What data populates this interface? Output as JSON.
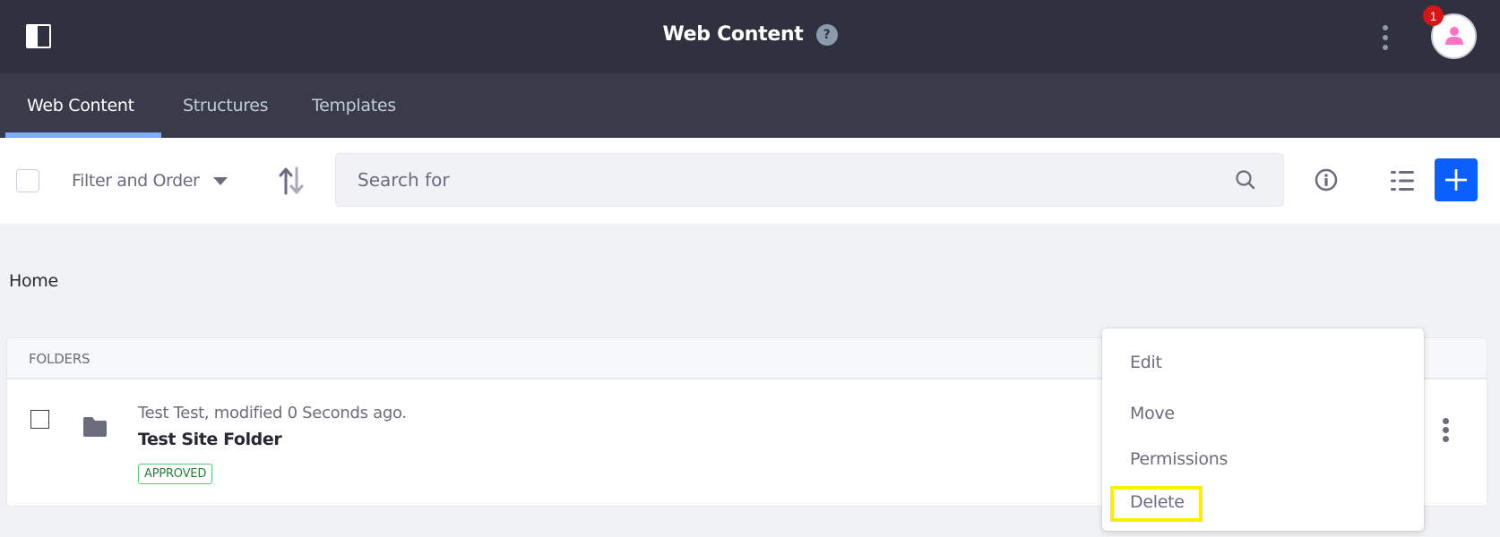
{
  "header": {
    "title": "Web Content",
    "help_icon": "question-mark-icon",
    "notification_count": "1",
    "sidebar_toggle_icon": "sidebar-toggle-icon",
    "options_icon": "vertical-ellipsis-icon",
    "avatar_icon": "user-icon"
  },
  "tabs": [
    {
      "label": "Web Content",
      "active": true
    },
    {
      "label": "Structures",
      "active": false
    },
    {
      "label": "Templates",
      "active": false
    }
  ],
  "toolbar": {
    "filter_label": "Filter and Order",
    "search_placeholder": "Search for",
    "search_value": "",
    "icons": {
      "sort": "order-arrows-icon",
      "search": "search-icon",
      "info": "info-circle-icon",
      "view": "list-view-icon",
      "add": "plus-icon"
    }
  },
  "breadcrumb": {
    "items": [
      "Home"
    ]
  },
  "folders": {
    "section_label": "FOLDERS",
    "rows": [
      {
        "meta": "Test Test, modified 0 Seconds ago.",
        "title": "Test Site Folder",
        "status": "APPROVED",
        "icon": "folder-icon"
      }
    ]
  },
  "dropdown_menu": {
    "items": [
      {
        "label": "Edit"
      },
      {
        "label": "Move"
      },
      {
        "label": "Permissions"
      },
      {
        "label": "Delete",
        "highlighted": true
      }
    ],
    "highlight_color": "#ffee00"
  },
  "colors": {
    "header_bg": "#30313f",
    "tabs_bg": "#393a4a",
    "active_tab_underline": "#80acff",
    "primary": "#0b5fff",
    "notification": "#da1414",
    "approved": "#287d3c",
    "avatar_accent": "#ff73c3"
  }
}
